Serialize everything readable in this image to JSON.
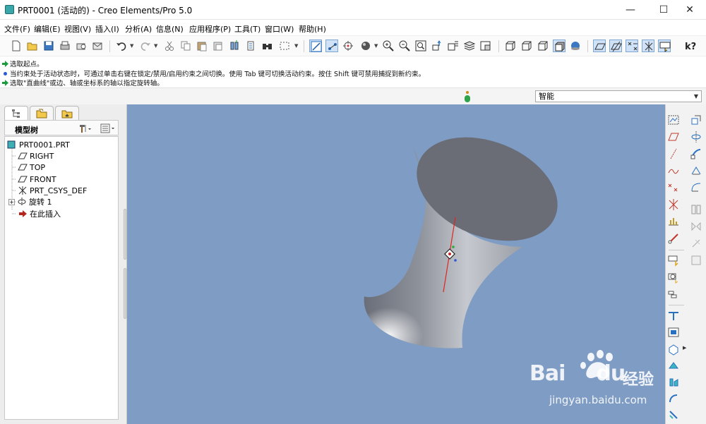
{
  "window": {
    "title": "PRT0001 (活动的) - Creo Elements/Pro 5.0",
    "minimize_glyph": "—",
    "maximize_glyph": "☐",
    "close_glyph": "✕"
  },
  "menu": [
    "文件(F)",
    "编辑(E)",
    "视图(V)",
    "插入(I)",
    "分析(A)",
    "信息(N)",
    "应用程序(P)",
    "工具(T)",
    "窗口(W)",
    "帮助(H)"
  ],
  "toolbar": {
    "icons": [
      "new-icon",
      "open-icon",
      "save-icon",
      "print-icon",
      "send-icon",
      "email-icon",
      "undo-icon",
      "redo-icon",
      "cut-icon",
      "copy-icon",
      "paste-icon",
      "paste-special-icon",
      "regenerate-icon",
      "regenerate-manager-icon",
      "find-icon",
      "select-box-icon",
      "sketch-icon",
      "datum-icon",
      "spin-center-icon",
      "shading-icon",
      "zoom-in-icon",
      "zoom-out-icon",
      "refit-icon",
      "reorient-icon",
      "saved-views-icon",
      "layers-icon",
      "view-manager-icon",
      "wireframe-icon",
      "hidden-line-icon",
      "no-hidden-icon",
      "shading-display-icon",
      "enhanced-realism-icon",
      "datum-plane-display-icon",
      "datum-axis-display-icon",
      "datum-point-display-icon",
      "csys-display-icon",
      "annotation-display-icon",
      "help-icon"
    ],
    "pressed": [
      "sketch-icon",
      "datum-icon",
      "shading-display-icon",
      "datum-plane-display-icon",
      "datum-axis-display-icon",
      "datum-point-display-icon",
      "csys-display-icon",
      "annotation-display-icon"
    ]
  },
  "messages": [
    {
      "icon": "arrow-prompt",
      "text": "选取起点。"
    },
    {
      "icon": "info-bullet",
      "text": "当约束处于活动状态时，可通过单击右键在锁定/禁用/启用约束之间切换。使用 Tab 键可切换活动约束。按住 Shift 键可禁用捕捉到新约束。"
    },
    {
      "icon": "arrow-prompt",
      "text": "选取\"直曲线\"或边、轴或坐标系的轴以指定旋转轴。"
    }
  ],
  "filter": {
    "value": "智能"
  },
  "navigator": {
    "tabs": [
      "model-tree-tab",
      "folder-browser-tab",
      "favorites-tab"
    ],
    "tree_title": "模型树",
    "tree": [
      {
        "label": "PRT0001.PRT",
        "icon": "part-icon",
        "level": 0
      },
      {
        "label": "RIGHT",
        "icon": "datum-plane-icon",
        "level": 1
      },
      {
        "label": "TOP",
        "icon": "datum-plane-icon",
        "level": 1
      },
      {
        "label": "FRONT",
        "icon": "datum-plane-icon",
        "level": 1
      },
      {
        "label": "PRT_CSYS_DEF",
        "icon": "csys-icon",
        "level": 1
      },
      {
        "label": "旋转 1",
        "icon": "revolve-icon",
        "level": 1,
        "expandable": true
      },
      {
        "label": "在此插入",
        "icon": "insert-arrow-icon",
        "level": 1
      }
    ]
  },
  "graphics": {
    "background": "#7e9cc4",
    "model": "revolved-hourglass-shape",
    "watermark": {
      "brand": "Bai",
      "brand2": "du",
      "name": "经验",
      "url": "jingyan.baidu.com"
    }
  },
  "right_toolbar": {
    "icons": [
      "sketch-tool-icon",
      "datum-plane-tool-icon",
      "datum-axis-tool-icon",
      "datum-curve-tool-icon",
      "datum-point-tool-icon",
      "datum-csys-tool-icon",
      "analysis-tool-icon",
      "publish-geom-icon",
      "insert-feature-icon",
      "group-icon",
      "merge-icon",
      "extrude-tool-icon",
      "revolve-tool-icon",
      "sweep-tool-icon",
      "blend-tool-icon",
      "boundary-blend-icon",
      "style-icon",
      "mirror-tool-icon",
      "trim-tool-icon",
      "offset-tool-icon",
      "thicken-tool-icon",
      "solidify-tool-icon",
      "hole-tool-icon",
      "shell-tool-icon",
      "rib-tool-icon",
      "draft-tool-icon",
      "round-tool-icon",
      "chamfer-tool-icon"
    ]
  },
  "colors": {
    "accent": "#1f6cc1",
    "prompt_green": "#1a9b3c",
    "info_blue": "#2a5ad8"
  }
}
